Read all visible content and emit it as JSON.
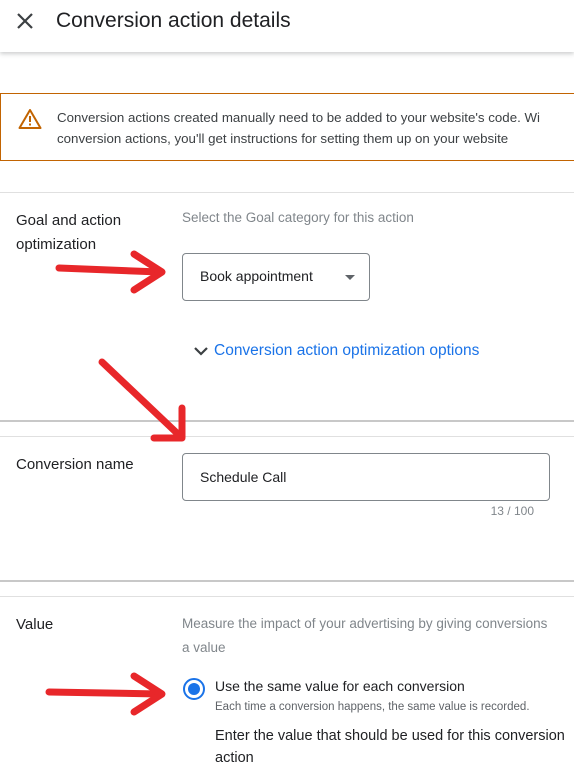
{
  "header": {
    "title": "Conversion action details",
    "close_icon": "close-icon"
  },
  "notice": {
    "line1": "Conversion actions created manually need to be added to your website's code. Wi",
    "line2": "conversion actions, you'll get instructions for setting them up on your website",
    "icon": "warning-icon",
    "color": "#c26401"
  },
  "goal_section": {
    "label_line1": "Goal and action",
    "label_line2": "optimization",
    "helper": "Select the Goal category for this action",
    "dropdown_value": "Book appointment",
    "expand_label": "Conversion action optimization options"
  },
  "name_section": {
    "label": "Conversion name",
    "input_value": "Schedule Call",
    "char_count": "13 / 100"
  },
  "value_section": {
    "label": "Value",
    "helper_line1": "Measure the impact of your advertising by giving conversions",
    "helper_line2": "a value",
    "radio_label": "Use the same value for each conversion",
    "radio_sub": "Each time a conversion happens, the same value is recorded.",
    "enter_text": "Enter the value that should be used for this conversion action"
  },
  "colors": {
    "accent": "#1a73e8",
    "annotation_arrow": "#e8272a"
  }
}
